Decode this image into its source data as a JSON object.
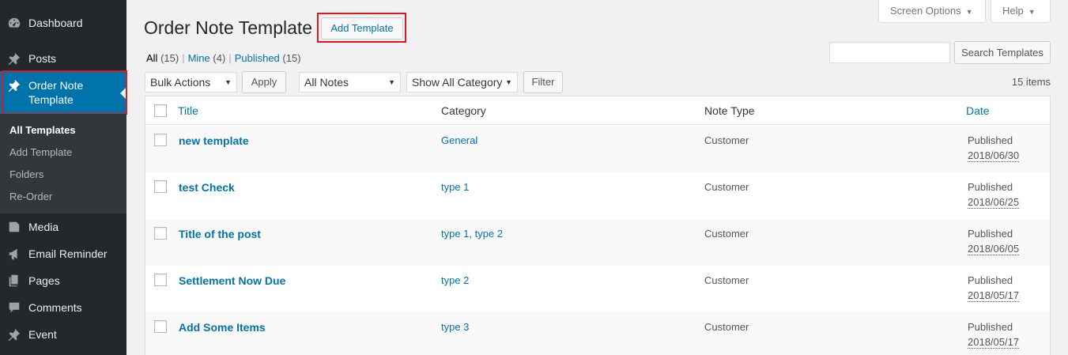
{
  "sidebar": {
    "items": [
      {
        "label": "Dashboard",
        "icon": "dashboard-icon"
      },
      {
        "label": "Posts",
        "icon": "pin-icon"
      },
      {
        "label": "Order Note Template",
        "label_line1": "Order Note",
        "label_line2": "Template",
        "icon": "pin-icon",
        "active": true
      },
      {
        "label": "Media",
        "icon": "media-icon"
      },
      {
        "label": "Email Reminder",
        "icon": "megaphone-icon"
      },
      {
        "label": "Pages",
        "icon": "pages-icon"
      },
      {
        "label": "Comments",
        "icon": "comment-icon"
      },
      {
        "label": "Event",
        "icon": "pin-icon"
      }
    ],
    "submenu": [
      "All Templates",
      "Add Template",
      "Folders",
      "Re-Order"
    ]
  },
  "header": {
    "title": "Order Note Template",
    "add_button": "Add Template",
    "screen_options": "Screen Options",
    "help": "Help"
  },
  "views": {
    "all": "All",
    "all_count": "(15)",
    "mine": "Mine",
    "mine_count": "(4)",
    "published": "Published",
    "published_count": "(15)"
  },
  "search": {
    "value": "",
    "button": "Search Templates"
  },
  "tablenav": {
    "bulk_actions": "Bulk Actions",
    "apply": "Apply",
    "notes_filter": "All Notes",
    "category_filter": "Show All Category",
    "filter": "Filter",
    "items_count": "15 items"
  },
  "table": {
    "columns": [
      "Title",
      "Category",
      "Note Type",
      "Date"
    ],
    "rows": [
      {
        "title": "new template",
        "category": "General",
        "note_type": "Customer",
        "status": "Published",
        "date": "2018/06/30"
      },
      {
        "title": "test Check",
        "category": "type 1",
        "note_type": "Customer",
        "status": "Published",
        "date": "2018/06/25"
      },
      {
        "title": "Title of the post",
        "category": "type 1, type 2",
        "note_type": "Customer",
        "status": "Published",
        "date": "2018/06/05"
      },
      {
        "title": "Settlement Now Due",
        "category": "type 2",
        "note_type": "Customer",
        "status": "Published",
        "date": "2018/05/17"
      },
      {
        "title": "Add Some Items",
        "category": "type 3",
        "note_type": "Customer",
        "status": "Published",
        "date": "2018/05/17"
      }
    ]
  },
  "colors": {
    "sidebar_bg": "#23282d",
    "active_bg": "#0073aa",
    "link": "#0073aa",
    "highlight_outline": "#e0181b"
  }
}
